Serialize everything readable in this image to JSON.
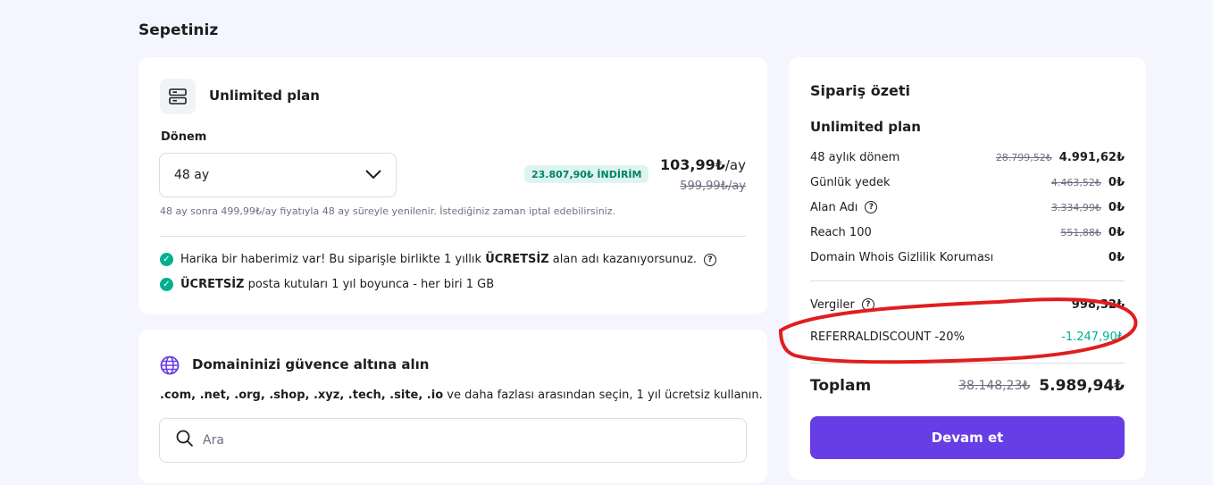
{
  "page": {
    "title": "Sepetiniz"
  },
  "plan": {
    "name": "Unlimited plan",
    "icon": "server-icon",
    "period_label": "Dönem",
    "period_value": "48 ay",
    "discount_badge": "23.807,90₺ İNDİRİM",
    "price": "103,99₺",
    "price_unit": "/ay",
    "price_old": "599,99₺/ay",
    "renew_note": "48 ay sonra 499,99₺/ay fiyatıyla 48 ay süreyle yenilenir. İstediğiniz zaman iptal edebilirsiniz.",
    "features": [
      {
        "pre": "Harika bir haberimiz var! Bu siparişle birlikte 1 yıllık ",
        "bold": "ÜCRETSİZ",
        "post": " alan adı kazanıyorsunuz."
      },
      {
        "pre": "",
        "bold": "ÜCRETSİZ",
        "post": " posta kutuları 1 yıl boyunca - her biri 1 GB"
      }
    ]
  },
  "domain": {
    "title": "Domaininizi güvence altına alın",
    "desc_bold": ".com, .net, .org, .shop, .xyz, .tech, .site, .io",
    "desc_rest": " ve daha fazlası arasından seçin, 1 yıl ücretsiz kullanın.",
    "search_placeholder": "Ara"
  },
  "summary": {
    "title": "Sipariş özeti",
    "plan_name": "Unlimited plan",
    "rows": [
      {
        "label": "48 aylık dönem",
        "old": "28.799,52₺",
        "new": "4.991,62₺"
      },
      {
        "label": "Günlük yedek",
        "old": "4.463,52₺",
        "new": "0₺"
      },
      {
        "label": "Alan Adı",
        "old": "3.334,99₺",
        "new": "0₺"
      },
      {
        "label": "Reach 100",
        "old": "551,88₺",
        "new": "0₺"
      },
      {
        "label": "Domain Whois Gizlilik Koruması",
        "old": "",
        "new": "0₺"
      }
    ],
    "tax_label": "Vergiler",
    "tax_value": "998,32₺",
    "discount_label": "REFERRALDISCOUNT -20%",
    "discount_value": "-1.247,90₺",
    "total_label": "Toplam",
    "total_old": "38.148,23₺",
    "total_new": "5.989,94₺",
    "continue_label": "Devam et"
  },
  "colors": {
    "accent": "#673de6",
    "success": "#00b090",
    "annotation": "#e01e1e"
  }
}
